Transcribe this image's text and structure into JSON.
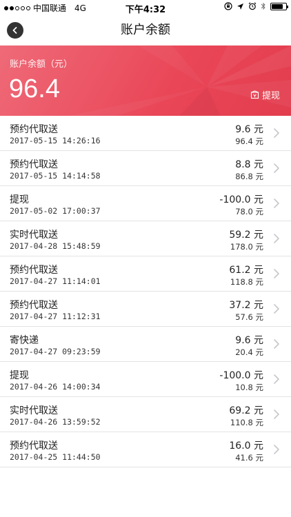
{
  "status_bar": {
    "carrier": "中国联通",
    "network": "4G",
    "time": "下午4:32"
  },
  "nav": {
    "title": "账户余额",
    "back_icon": "chevron-left-icon"
  },
  "balance": {
    "label": "账户余额（元）",
    "value": "96.4",
    "withdraw_label": "提现",
    "withdraw_icon": "wallet-icon"
  },
  "colors": {
    "card_red": "#e94657",
    "divider": "#e3e3e3",
    "chevron": "#c7c7cc"
  },
  "transactions": [
    {
      "title": "预约代取送",
      "date": "2017-05-15 14:26:16",
      "amount": "9.6 元",
      "balance": "96.4 元"
    },
    {
      "title": "预约代取送",
      "date": "2017-05-15 14:14:58",
      "amount": "8.8 元",
      "balance": "86.8 元"
    },
    {
      "title": "提现",
      "date": "2017-05-02 17:00:37",
      "amount": "-100.0 元",
      "balance": "78.0 元"
    },
    {
      "title": "实时代取送",
      "date": "2017-04-28 15:48:59",
      "amount": "59.2 元",
      "balance": "178.0 元"
    },
    {
      "title": "预约代取送",
      "date": "2017-04-27 11:14:01",
      "amount": "61.2 元",
      "balance": "118.8 元"
    },
    {
      "title": "预约代取送",
      "date": "2017-04-27 11:12:31",
      "amount": "37.2 元",
      "balance": "57.6 元"
    },
    {
      "title": "寄快递",
      "date": "2017-04-27 09:23:59",
      "amount": "9.6 元",
      "balance": "20.4 元"
    },
    {
      "title": "提现",
      "date": "2017-04-26 14:00:34",
      "amount": "-100.0 元",
      "balance": "10.8 元"
    },
    {
      "title": "实时代取送",
      "date": "2017-04-26 13:59:52",
      "amount": "69.2 元",
      "balance": "110.8 元"
    },
    {
      "title": "预约代取送",
      "date": "2017-04-25 11:44:50",
      "amount": "16.0 元",
      "balance": "41.6 元"
    }
  ]
}
